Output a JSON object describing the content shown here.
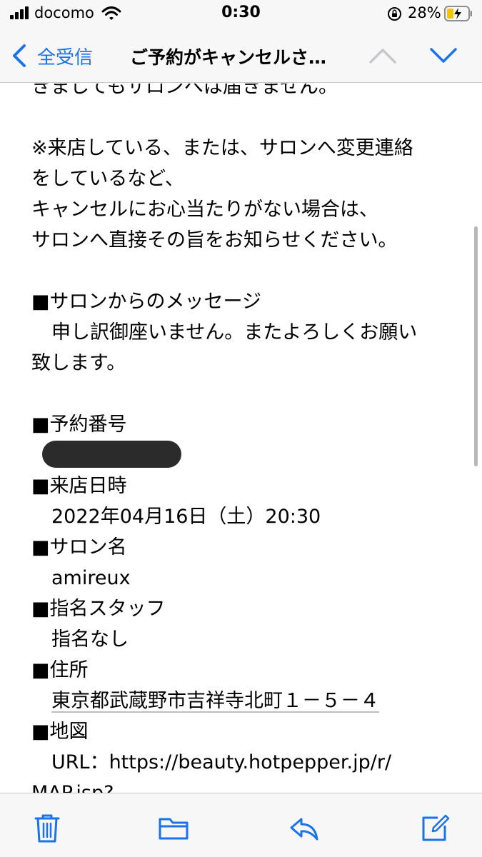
{
  "status_bar": {
    "carrier": "docomo",
    "time": "0:30",
    "battery_percent": "28%",
    "icons": [
      "signal-icon",
      "wifi-icon",
      "rotation-lock-icon",
      "battery-charging-icon"
    ]
  },
  "nav": {
    "back_label": "全受信",
    "title": "ご予約がキャンセルさ…",
    "icons": [
      "back-chevron-icon",
      "previous-message-icon",
      "next-message-icon"
    ]
  },
  "body": {
    "cut_top": "きましてもサロンへは届きません。",
    "note_1": "※来店している、または、サロンへ変更連絡",
    "note_2": "をしているなど、",
    "note_3": "キャンセルにお心当たりがない場合は、",
    "note_4": "サロンへ直接その旨をお知らせください。",
    "bullet": "■",
    "msg_heading": "サロンからのメッセージ",
    "msg_1": "申し訳御座いません。またよろしくお願い",
    "msg_2": "致します。",
    "booking_no_heading": "予約番号",
    "visit_heading": "来店日時",
    "visit_value": "2022年04月16日（土）20:30",
    "salon_heading": "サロン名",
    "salon_value": "amireux",
    "staff_heading": "指名スタッフ",
    "staff_value": "指名なし",
    "address_heading": "住所",
    "address_value": "東京都武蔵野市吉祥寺北町１－５－４",
    "map_heading": "地図",
    "map_url": "URL：https://beauty.hotpepper.jp/r/",
    "map_url_cut": "MAP.jsp?"
  },
  "toolbar": {
    "icons": [
      "trash-icon",
      "folder-icon",
      "reply-icon",
      "compose-icon"
    ],
    "accent": "#1a73e8"
  }
}
